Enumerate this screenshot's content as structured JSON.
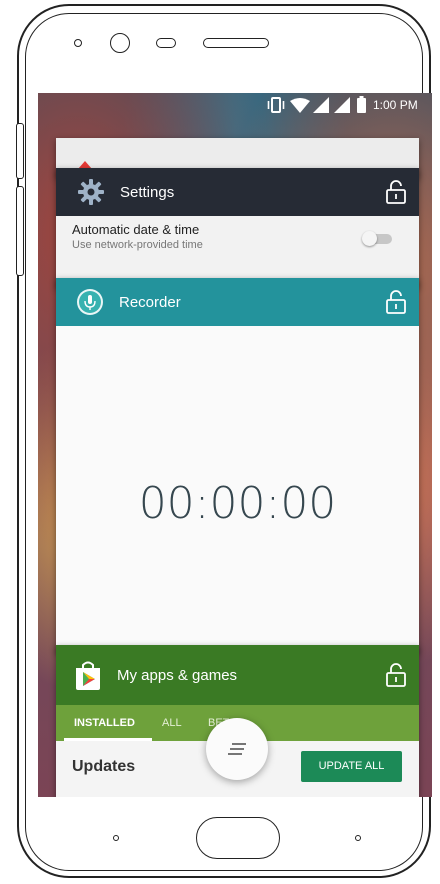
{
  "status_bar": {
    "time": "1:00 PM"
  },
  "cards": {
    "settings": {
      "title": "Settings",
      "setting_title": "Automatic date & time",
      "setting_subtitle": "Use network-provided time"
    },
    "recorder": {
      "title": "Recorder",
      "timer": "00:00:00"
    },
    "play_store": {
      "title": "My apps & games",
      "tabs": [
        "INSTALLED",
        "ALL",
        "BETA"
      ],
      "section": "Updates",
      "update_all": "UPDATE ALL"
    }
  },
  "icons": {
    "status": [
      "vibrate-icon",
      "wifi-icon",
      "signal-icon",
      "signal-icon-2",
      "battery-icon"
    ],
    "recent_menu": "menu-icon"
  },
  "colors": {
    "settings_header": "#262b35",
    "recorder_header": "#23939c",
    "play_header": "#3a7a24",
    "play_tabs": "#6ea13b",
    "update_button": "#1c8a57",
    "timer_text": "#36474f"
  }
}
